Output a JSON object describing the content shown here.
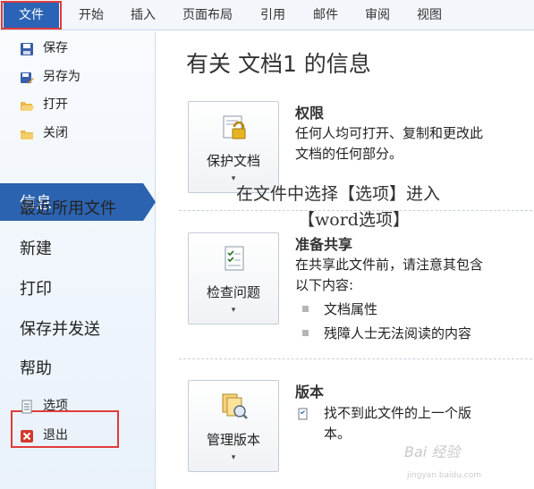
{
  "ribbon": {
    "tabs": [
      "文件",
      "开始",
      "插入",
      "页面布局",
      "引用",
      "邮件",
      "审阅",
      "视图"
    ]
  },
  "backstage": {
    "commands_top": [
      "保存",
      "另存为",
      "打开",
      "关闭"
    ],
    "selected_tab": "信息",
    "tabs": [
      "最近所用文件",
      "新建",
      "打印",
      "保存并发送",
      "帮助"
    ],
    "commands_bottom": [
      "选项",
      "退出"
    ]
  },
  "info": {
    "title": "有关 文档1 的信息",
    "permissions": {
      "button_label": "保护文档",
      "heading": "权限",
      "text_lines": [
        "任何人均可打开、复制和更改此",
        "文档的任何部分。"
      ]
    },
    "prepare": {
      "button_label": "检查问题",
      "heading": "准备共享",
      "text_lines": [
        "在共享此文件前，请注意其包含",
        "以下内容:"
      ],
      "bullets": [
        "文档属性",
        "残障人士无法阅读的内容"
      ]
    },
    "versions": {
      "button_label": "管理版本",
      "heading": "版本",
      "text_lines": [
        "找不到此文件的上一个版",
        "本。"
      ]
    }
  },
  "annotation": {
    "line1": "在文件中选择【选项】进入",
    "line2": "【word选项】"
  },
  "watermark": {
    "text": "Bai 经验",
    "sub": "jingyan.baidu.com"
  },
  "colors": {
    "accent": "#2c63b0",
    "highlight_box": "#e03b3b"
  }
}
